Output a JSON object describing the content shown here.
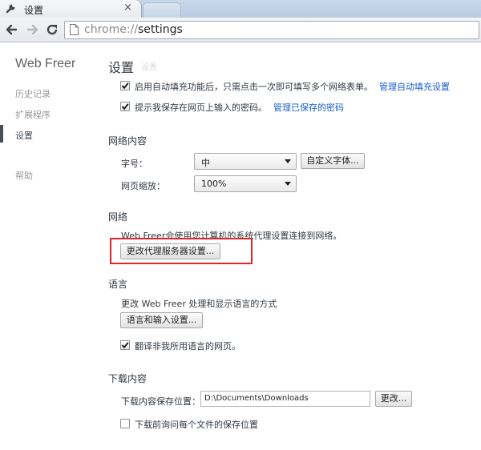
{
  "tab": {
    "title": "设置",
    "close_glyph": "×",
    "icon": "wrench-icon"
  },
  "toolbar": {
    "url_scheme": "chrome://",
    "url_path": "settings"
  },
  "sidebar": {
    "title": "Web Freer",
    "items": [
      {
        "label": "历史记录"
      },
      {
        "label": "扩展程序"
      },
      {
        "label": "设置"
      },
      {
        "label": "帮助"
      }
    ]
  },
  "main": {
    "title": "设置",
    "ghost_title": "设置",
    "autofill": {
      "checkbox1_label": "启用自动填充功能后，只需点击一次即可填写多个网络表单。",
      "checkbox1_link": "管理自动填充设置",
      "checkbox1_checked": true,
      "checkbox2_label": "提示我保存在网页上输入的密码。",
      "checkbox2_link": "管理已保存的密码",
      "checkbox2_checked": true
    },
    "web_content": {
      "title": "网络内容",
      "font_size_label": "字号：",
      "font_size_value": "中",
      "custom_fonts_button": "自定义字体...",
      "zoom_label": "网页缩放：",
      "zoom_value": "100%"
    },
    "network": {
      "title": "网络",
      "description": "Web Freer会使用您计算机的系统代理设置连接到网络。",
      "proxy_button": "更改代理服务器设置..."
    },
    "language": {
      "title": "语言",
      "description": "更改 Web Freer 处理和显示语言的方式",
      "language_button": "语言和输入设置...",
      "translate_label": "翻译非我所用语言的网页。",
      "translate_checked": true
    },
    "downloads": {
      "title": "下载内容",
      "location_label": "下载内容保存位置：",
      "location_value": "D:\\Documents\\Downloads",
      "change_button": "更改...",
      "ask_label": "下载前询问每个文件的保存位置",
      "ask_checked": false
    }
  },
  "colors": {
    "link": "#1a5fcd",
    "highlight_border": "#e0262a",
    "sidebar_selected_marker": "#464e5a"
  }
}
